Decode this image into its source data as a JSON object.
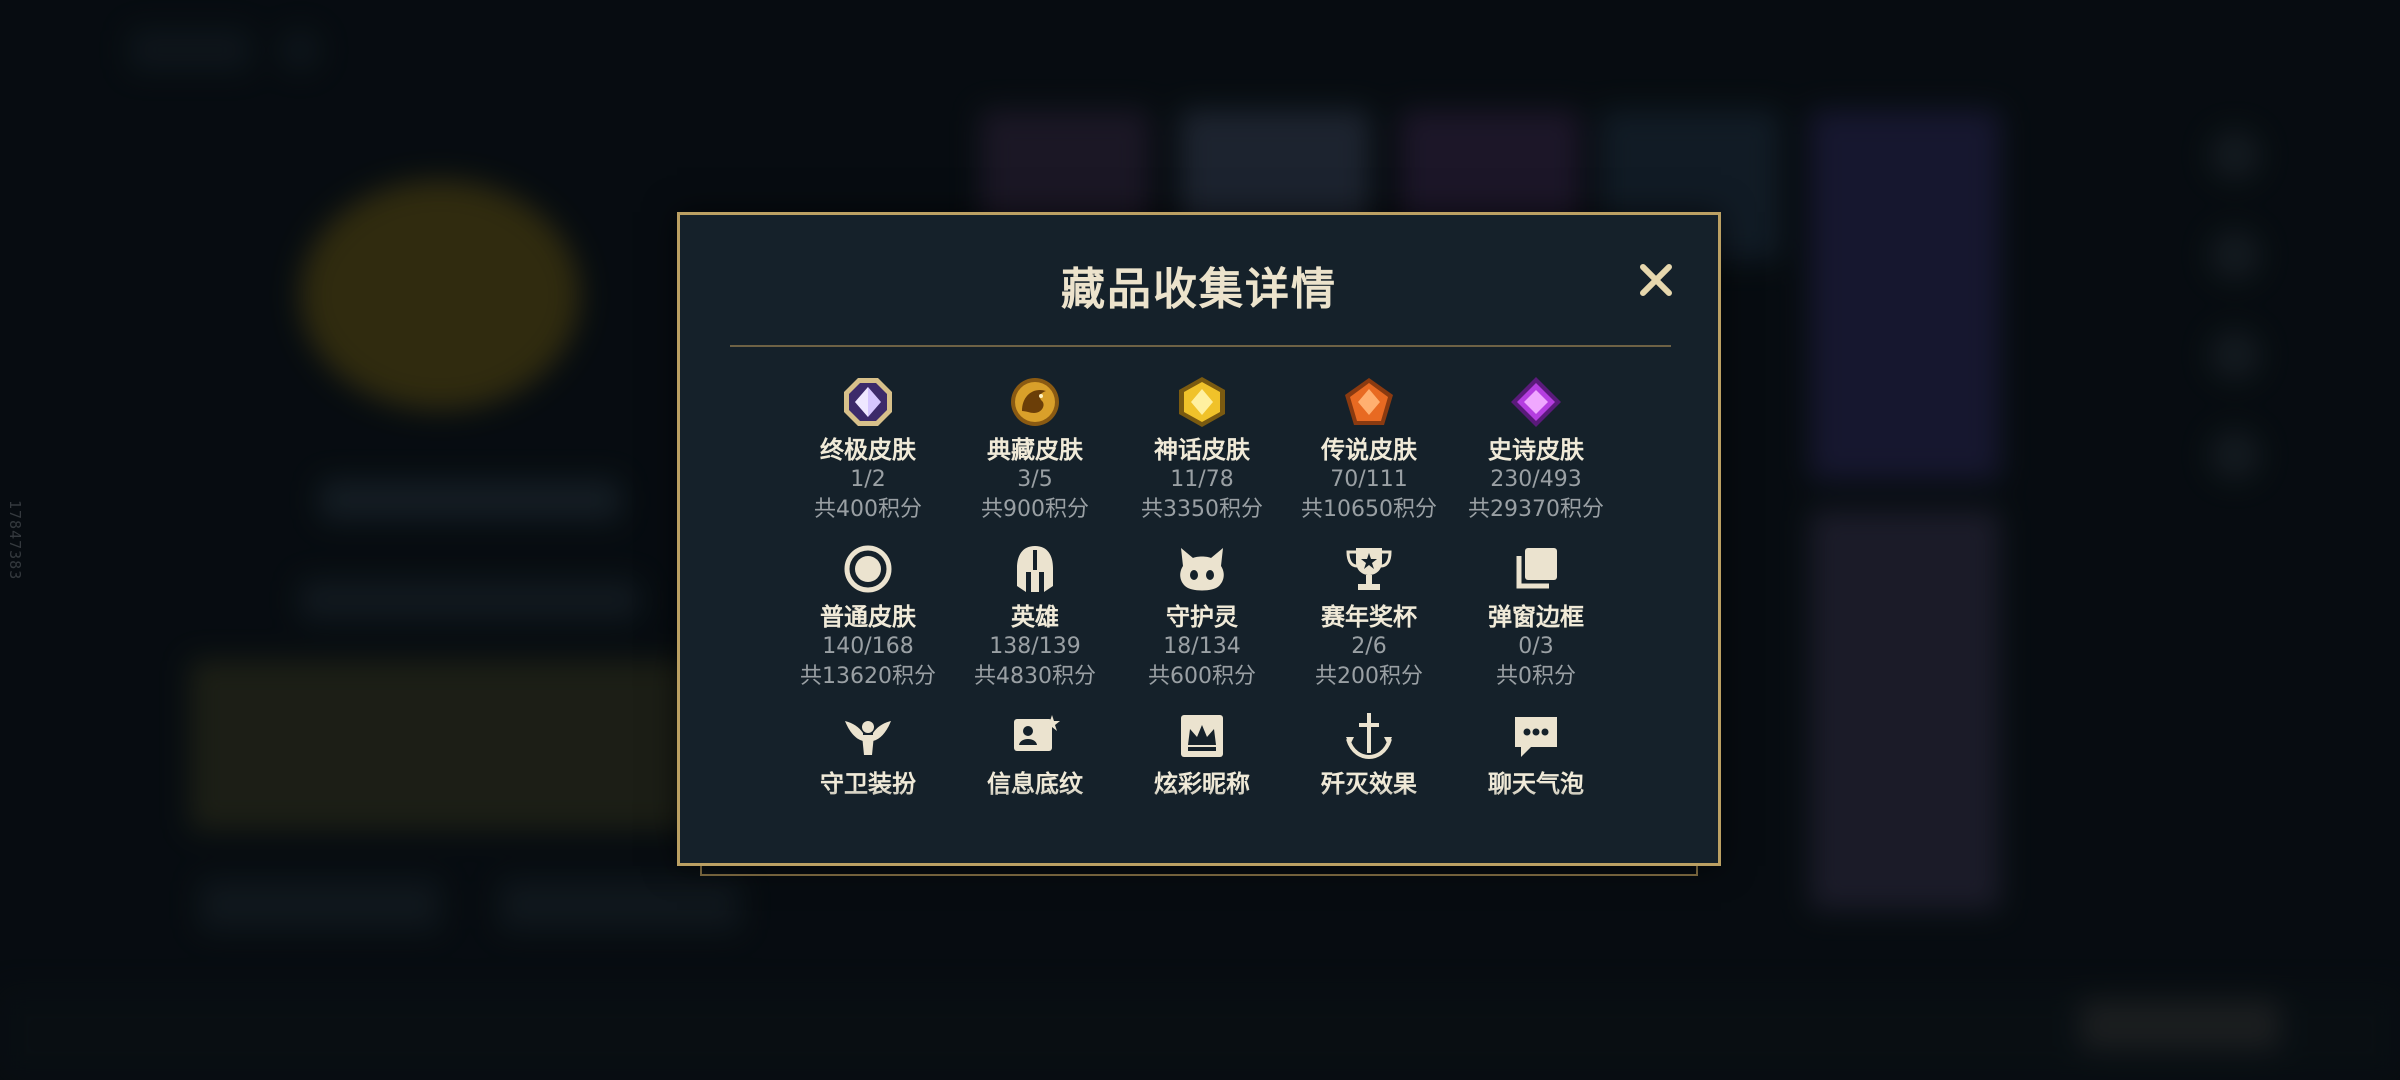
{
  "background": {
    "side_id": "17847383"
  },
  "modal": {
    "title": "藏品收集详情",
    "close_icon": "close-x-icon",
    "accent_color": "#bba063",
    "items": [
      {
        "icon": "octagon-crystal-icon",
        "name": "终极皮肤",
        "count": "1/2",
        "points": "共400积分"
      },
      {
        "icon": "golden-dragon-icon",
        "name": "典藏皮肤",
        "count": "3/5",
        "points": "共900积分"
      },
      {
        "icon": "hexagon-gem-icon",
        "name": "神话皮肤",
        "count": "11/78",
        "points": "共3350积分"
      },
      {
        "icon": "pentagon-gem-icon",
        "name": "传说皮肤",
        "count": "70/111",
        "points": "共10650积分"
      },
      {
        "icon": "diamond-gem-icon",
        "name": "史诗皮肤",
        "count": "230/493",
        "points": "共29370积分"
      },
      {
        "icon": "ring-icon",
        "name": "普通皮肤",
        "count": "140/168",
        "points": "共13620积分"
      },
      {
        "icon": "helmet-icon",
        "name": "英雄",
        "count": "138/139",
        "points": "共4830积分"
      },
      {
        "icon": "spirit-creature-icon",
        "name": "守护灵",
        "count": "18/134",
        "points": "共600积分"
      },
      {
        "icon": "trophy-icon",
        "name": "赛年奖杯",
        "count": "2/6",
        "points": "共200积分"
      },
      {
        "icon": "stacked-frames-icon",
        "name": "弹窗边框",
        "count": "0/3",
        "points": "共0积分"
      },
      {
        "icon": "winged-guardian-icon",
        "name": "守卫装扮",
        "count": "",
        "points": ""
      },
      {
        "icon": "profile-card-icon",
        "name": "信息底纹",
        "count": "",
        "points": ""
      },
      {
        "icon": "crown-frame-icon",
        "name": "炫彩昵称",
        "count": "",
        "points": ""
      },
      {
        "icon": "sword-anchor-icon",
        "name": "歼灭效果",
        "count": "",
        "points": ""
      },
      {
        "icon": "chat-bubble-icon",
        "name": "聊天气泡",
        "count": "",
        "points": ""
      }
    ]
  }
}
